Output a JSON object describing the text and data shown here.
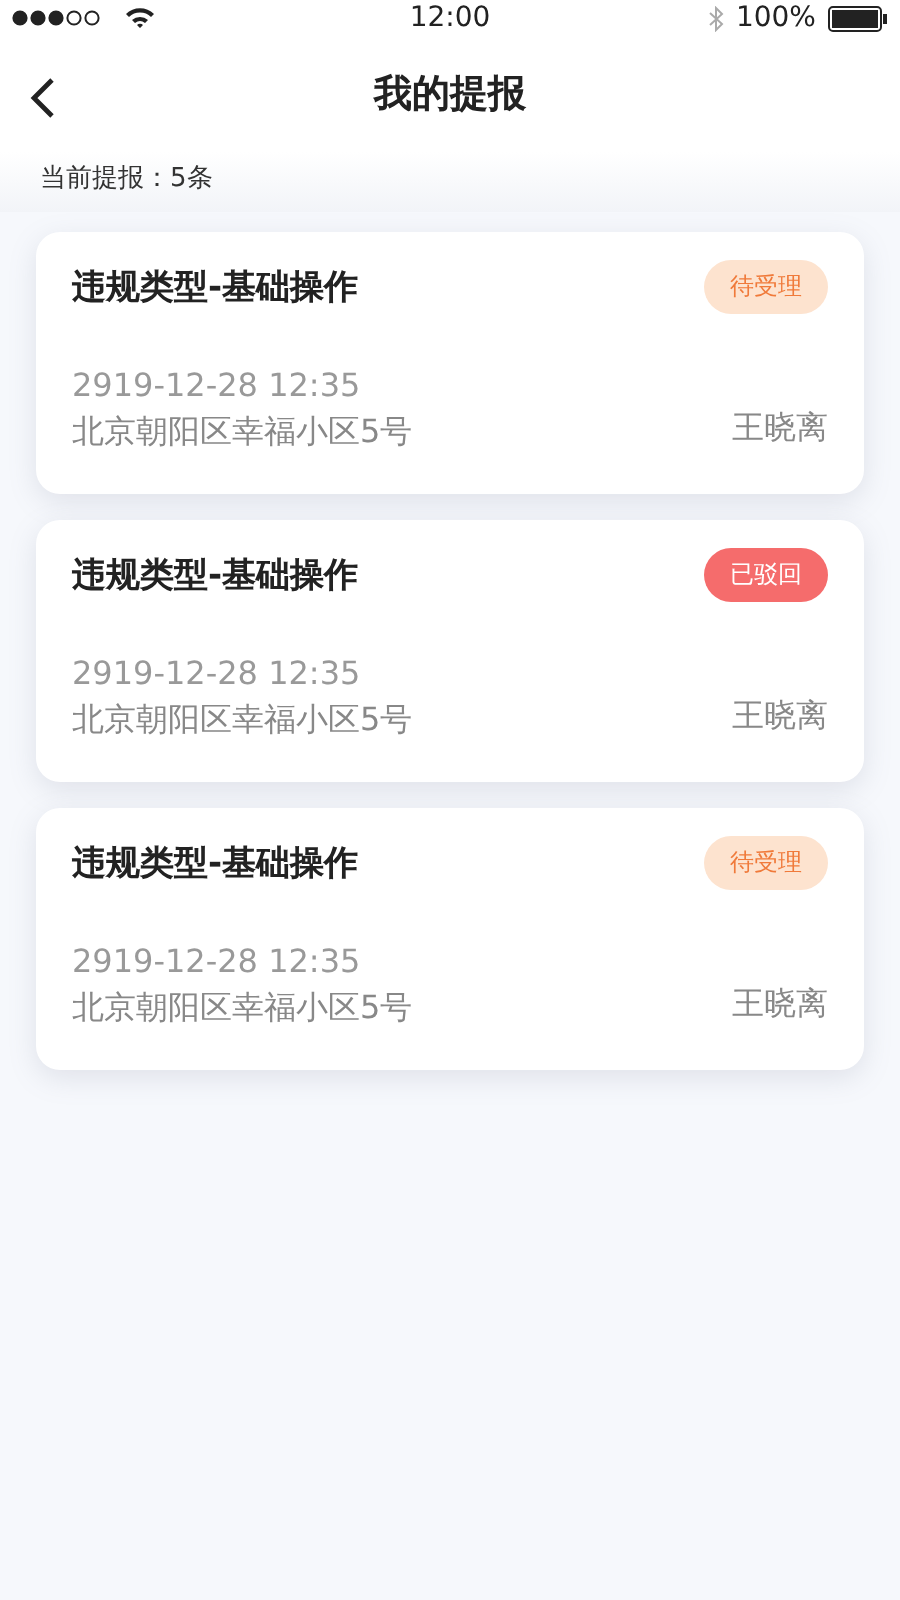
{
  "status_bar": {
    "time": "12:00",
    "battery": "100%"
  },
  "nav": {
    "title": "我的提报"
  },
  "summary": "当前提报：5条",
  "reports": [
    {
      "title": "违规类型-基础操作",
      "status": {
        "label": "待受理",
        "kind": "pending"
      },
      "time": "2919-12-28 12:35",
      "address": "北京朝阳区幸福小区5号",
      "person": "王晓离"
    },
    {
      "title": "违规类型-基础操作",
      "status": {
        "label": "已驳回",
        "kind": "rejected"
      },
      "time": "2919-12-28 12:35",
      "address": "北京朝阳区幸福小区5号",
      "person": "王晓离"
    },
    {
      "title": "违规类型-基础操作",
      "status": {
        "label": "待受理",
        "kind": "pending"
      },
      "time": "2919-12-28 12:35",
      "address": "北京朝阳区幸福小区5号",
      "person": "王晓离"
    }
  ]
}
